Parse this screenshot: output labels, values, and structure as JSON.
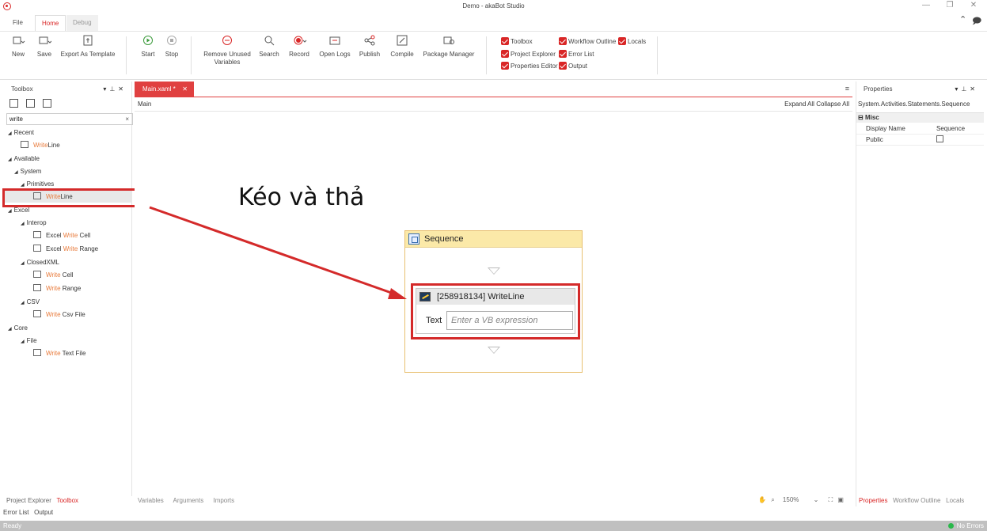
{
  "window": {
    "title": "Demo - akaBot Studio"
  },
  "menu_tabs": [
    {
      "label": "File"
    },
    {
      "label": "Home"
    },
    {
      "label": "Debug"
    }
  ],
  "ribbon": {
    "new": "New",
    "save": "Save",
    "export": "Export As Template",
    "start": "Start",
    "stop": "Stop",
    "remove_unused_1": "Remove Unused",
    "remove_unused_2": "Variables",
    "search": "Search",
    "record": "Record",
    "open_logs": "Open Logs",
    "publish": "Publish",
    "compile": "Compile",
    "package_manager": "Package Manager",
    "checks": {
      "toolbox": "Toolbox",
      "workflow_outline": "Workflow Outline",
      "locals": "Locals",
      "project_explorer": "Project Explorer",
      "error_list": "Error List",
      "properties_editor": "Properties Editor",
      "output": "Output"
    }
  },
  "toolbox": {
    "title": "Toolbox",
    "search_value": "write",
    "items": {
      "recent": "Recent",
      "recent_writeline_hl": "Write",
      "recent_writeline_rest": "Line",
      "available": "Available",
      "system": "System",
      "primitives": "Primitives",
      "prim_writeline_hl": "Write",
      "prim_writeline_rest": "Line",
      "excel": "Excel",
      "interop": "Interop",
      "excel_write_cell_a": "Excel ",
      "excel_write_cell_hl": "Write",
      "excel_write_cell_b": " Cell",
      "excel_write_range_a": "Excel ",
      "excel_write_range_hl": "Write",
      "excel_write_range_b": " Range",
      "closedxml": "ClosedXML",
      "cx_write_cell_hl": "Write",
      "cx_write_cell_b": " Cell",
      "cx_write_range_hl": "Write",
      "cx_write_range_b": " Range",
      "csv": "CSV",
      "csv_write_hl": "Write",
      "csv_write_b": " Csv File",
      "core": "Core",
      "file": "File",
      "file_write_hl": "Write",
      "file_write_b": " Text File"
    }
  },
  "editor": {
    "tab_label": "Main.xaml *",
    "breadcrumb": "Main",
    "expand_all": "Expand All",
    "collapse_all": "Collapse All",
    "annotation": "Kéo và thả",
    "sequence_title": "Sequence",
    "writeline_title": "[258918134] WriteLine",
    "text_label": "Text",
    "text_placeholder": "Enter a VB expression",
    "bottom_tabs": [
      "Variables",
      "Arguments",
      "Imports"
    ],
    "zoom": "150%"
  },
  "properties": {
    "title": "Properties",
    "type": "System.Activities.Statements.Sequence",
    "section": "Misc",
    "display_name_key": "Display Name",
    "display_name_value": "Sequence",
    "public_key": "Public",
    "tabs": [
      "Properties",
      "Workflow Outline",
      "Locals"
    ]
  },
  "left_bottom_tabs": [
    "Project Explorer",
    "Toolbox"
  ],
  "bottom_row": [
    "Error List",
    "Output"
  ],
  "status": {
    "left": "Ready",
    "right": "No Errors"
  },
  "colors": {
    "accent": "#d92626",
    "highlight_text": "#e87a3a",
    "sequence_header": "#fbe9a8"
  }
}
